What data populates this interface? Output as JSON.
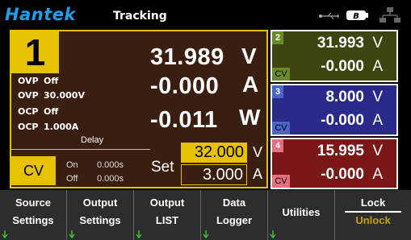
{
  "header": {
    "brand": "Hantek",
    "title": "Tracking",
    "icons": [
      "usb-icon",
      "battery-icon",
      "network-icon"
    ]
  },
  "channel1": {
    "number": "1",
    "voltage": "31.989",
    "voltage_unit": "V",
    "current": "-0.000",
    "current_unit": "A",
    "power": "-0.011",
    "power_unit": "W",
    "ovp_state_label": "OVP",
    "ovp_state": "Off",
    "ovp_value_label": "OVP",
    "ovp_value": "30.000V",
    "ocp_state_label": "OCP",
    "ocp_state": "Off",
    "ocp_value_label": "OCP",
    "ocp_value": "1.000A",
    "delay_label": "Delay",
    "mode": "CV",
    "on_label": "On",
    "on_time": "0.000s",
    "off_label": "Off",
    "off_time": "0.000s",
    "set_label": "Set",
    "set_voltage": "32.000",
    "set_voltage_unit": "V",
    "set_current": "3.000",
    "set_current_unit": "A"
  },
  "channels": [
    {
      "number": "2",
      "voltage": "31.993",
      "voltage_unit": "V",
      "current": "-0.000",
      "current_unit": "A",
      "mode": "CV",
      "bg_color": "#3f4510",
      "badge_color": "#6a8a2a"
    },
    {
      "number": "3",
      "voltage": "8.000",
      "voltage_unit": "V",
      "current": "-0.000",
      "current_unit": "A",
      "mode": "CV",
      "bg_color": "#2a2a8a",
      "badge_color": "#4a64c8"
    },
    {
      "number": "4",
      "voltage": "15.995",
      "voltage_unit": "V",
      "current": "-0.000",
      "current_unit": "A",
      "mode": "CV",
      "bg_color": "#7a1818",
      "badge_color": "#e66e7e"
    }
  ],
  "softkeys": {
    "source": {
      "line1": "Source",
      "line2": "Settings"
    },
    "output": {
      "line1": "Output",
      "line2": "Settings"
    },
    "output_list": {
      "line1": "Output",
      "line2": "LIST"
    },
    "data_logger": {
      "line1": "Data",
      "line2": "Logger"
    },
    "utilities": {
      "label": "Utilities"
    },
    "lock": {
      "line1": "Lock",
      "line2": "Unlock"
    }
  },
  "colors": {
    "accent_yellow": "#e7c200",
    "brand_blue": "#1ea0e8",
    "unlock_color": "#c8a000"
  }
}
